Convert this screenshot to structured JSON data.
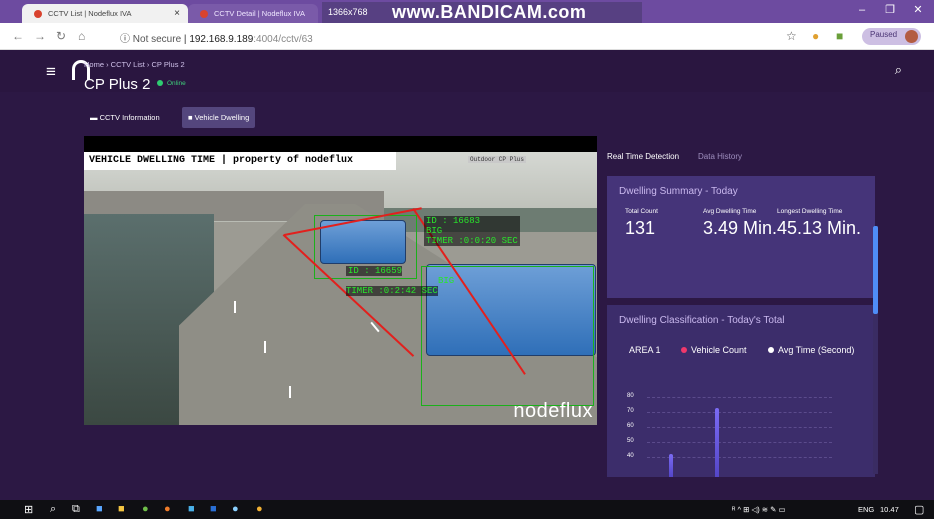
{
  "browser": {
    "tabs": [
      {
        "label": "CCTV List | Nodeflux IVA",
        "active": true
      },
      {
        "label": "CCTV Detail | Nodeflux IVA",
        "active": false
      }
    ],
    "recorder": {
      "resolution": "1366x768",
      "text": "www.BANDICAM.com"
    },
    "address": {
      "security": "Not secure",
      "host": "192.168.9.189",
      "path": ":4004/cctv/63"
    },
    "paused_label": "Paused"
  },
  "app": {
    "breadcrumb": "Home › CCTV List › CP Plus 2",
    "camera_name": "CP Plus 2",
    "status": "Online",
    "tabs": [
      {
        "label": "CCTV Information",
        "icon": "cctv-icon"
      },
      {
        "label": "Vehicle Dwelling",
        "icon": "camera-icon"
      }
    ]
  },
  "video": {
    "banner": "VEHICLE DWELLING TIME | property of nodeflux",
    "camera_tag": "Outdoor CP Plus",
    "detections": [
      {
        "id": "ID : 16683",
        "cls": "BIG",
        "timer": "TIMER :0:0:20 SEC"
      },
      {
        "id": "ID : 16659",
        "cls": "BIG",
        "timer": "TIMER :0:2:42 SEC"
      }
    ],
    "watermark": "nodeflux"
  },
  "panel": {
    "tabs": [
      "Real Time Detection",
      "Data History"
    ],
    "summary": {
      "title": "Dwelling Summary - Today",
      "total_count_label": "Total Count",
      "total_count": "131",
      "avg_label": "Avg Dwelling Time",
      "avg_value": "3.49 Min.",
      "longest_label": "Longest Dwelling Time",
      "longest_value": "45.13 Min."
    },
    "classification": {
      "title": "Dwelling Classification - Today's Total",
      "area": "AREA 1",
      "legend": [
        {
          "name": "Vehicle Count",
          "color": "#f0386b"
        },
        {
          "name": "Avg Time (Second)",
          "color": "#ffffff"
        }
      ]
    }
  },
  "chart_data": {
    "type": "bar",
    "yticks": [
      80,
      70,
      60,
      50,
      40
    ],
    "ylim": [
      40,
      80
    ],
    "bars": [
      42,
      73
    ]
  },
  "taskbar": {
    "lang": "ENG",
    "time": "10.47"
  }
}
